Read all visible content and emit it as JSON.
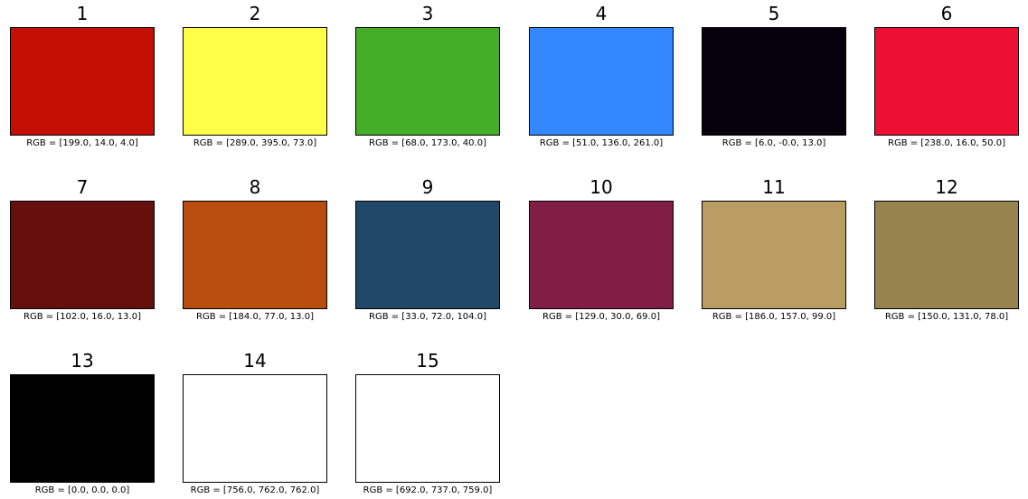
{
  "swatches": [
    {
      "title": "1",
      "color": "#c40f04",
      "caption": "RGB = [199.0, 14.0, 4.0]"
    },
    {
      "title": "2",
      "color": "#ffff49",
      "caption": "RGB = [289.0, 395.0, 73.0]"
    },
    {
      "title": "3",
      "color": "#44ad28",
      "caption": "RGB = [68.0, 173.0, 40.0]"
    },
    {
      "title": "4",
      "color": "#3388ff",
      "caption": "RGB = [51.0, 136.0, 261.0]"
    },
    {
      "title": "5",
      "color": "#06000d",
      "caption": "RGB = [6.0, -0.0, 13.0]"
    },
    {
      "title": "6",
      "color": "#ee1032",
      "caption": "RGB = [238.0, 16.0, 50.0]"
    },
    {
      "title": "7",
      "color": "#66100d",
      "caption": "RGB = [102.0, 16.0, 13.0]"
    },
    {
      "title": "8",
      "color": "#b84d0d",
      "caption": "RGB = [184.0, 77.0, 13.0]"
    },
    {
      "title": "9",
      "color": "#214868",
      "caption": "RGB = [33.0, 72.0, 104.0]"
    },
    {
      "title": "10",
      "color": "#811e45",
      "caption": "RGB = [129.0, 30.0, 69.0]"
    },
    {
      "title": "11",
      "color": "#ba9d63",
      "caption": "RGB = [186.0, 157.0, 99.0]"
    },
    {
      "title": "12",
      "color": "#96834e",
      "caption": "RGB = [150.0, 131.0, 78.0]"
    },
    {
      "title": "13",
      "color": "#000000",
      "caption": "RGB = [0.0, 0.0, 0.0]"
    },
    {
      "title": "14",
      "color": "#ffffff",
      "caption": "RGB = [756.0, 762.0, 762.0]"
    },
    {
      "title": "15",
      "color": "#ffffff",
      "caption": "RGB = [692.0, 737.0, 759.0]"
    }
  ]
}
